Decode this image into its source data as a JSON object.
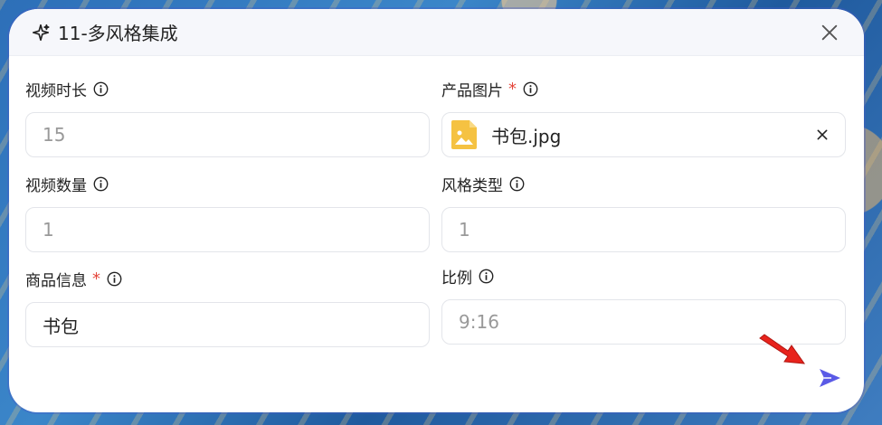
{
  "dialog": {
    "title": "11-多风格集成",
    "icons": {
      "header": "sparkle-icon",
      "close": "close-icon",
      "send": "send-icon"
    }
  },
  "fields": {
    "duration": {
      "label": "视频时长",
      "value": "15",
      "filled": false
    },
    "product_image": {
      "label": "产品图片",
      "required": "*",
      "file_name": "书包.jpg"
    },
    "count": {
      "label": "视频数量",
      "value": "1",
      "filled": false
    },
    "style_type": {
      "label": "风格类型",
      "value": "1",
      "filled": false
    },
    "product_info": {
      "label": "商品信息",
      "required": "*",
      "value": "书包",
      "filled": true
    },
    "ratio": {
      "label": "比例",
      "value": "9:16",
      "filled": false
    }
  },
  "colors": {
    "accent": "#5a5ae6",
    "required": "#e4463b",
    "annotation": "#e8231c",
    "file_icon": "#f5c242"
  }
}
